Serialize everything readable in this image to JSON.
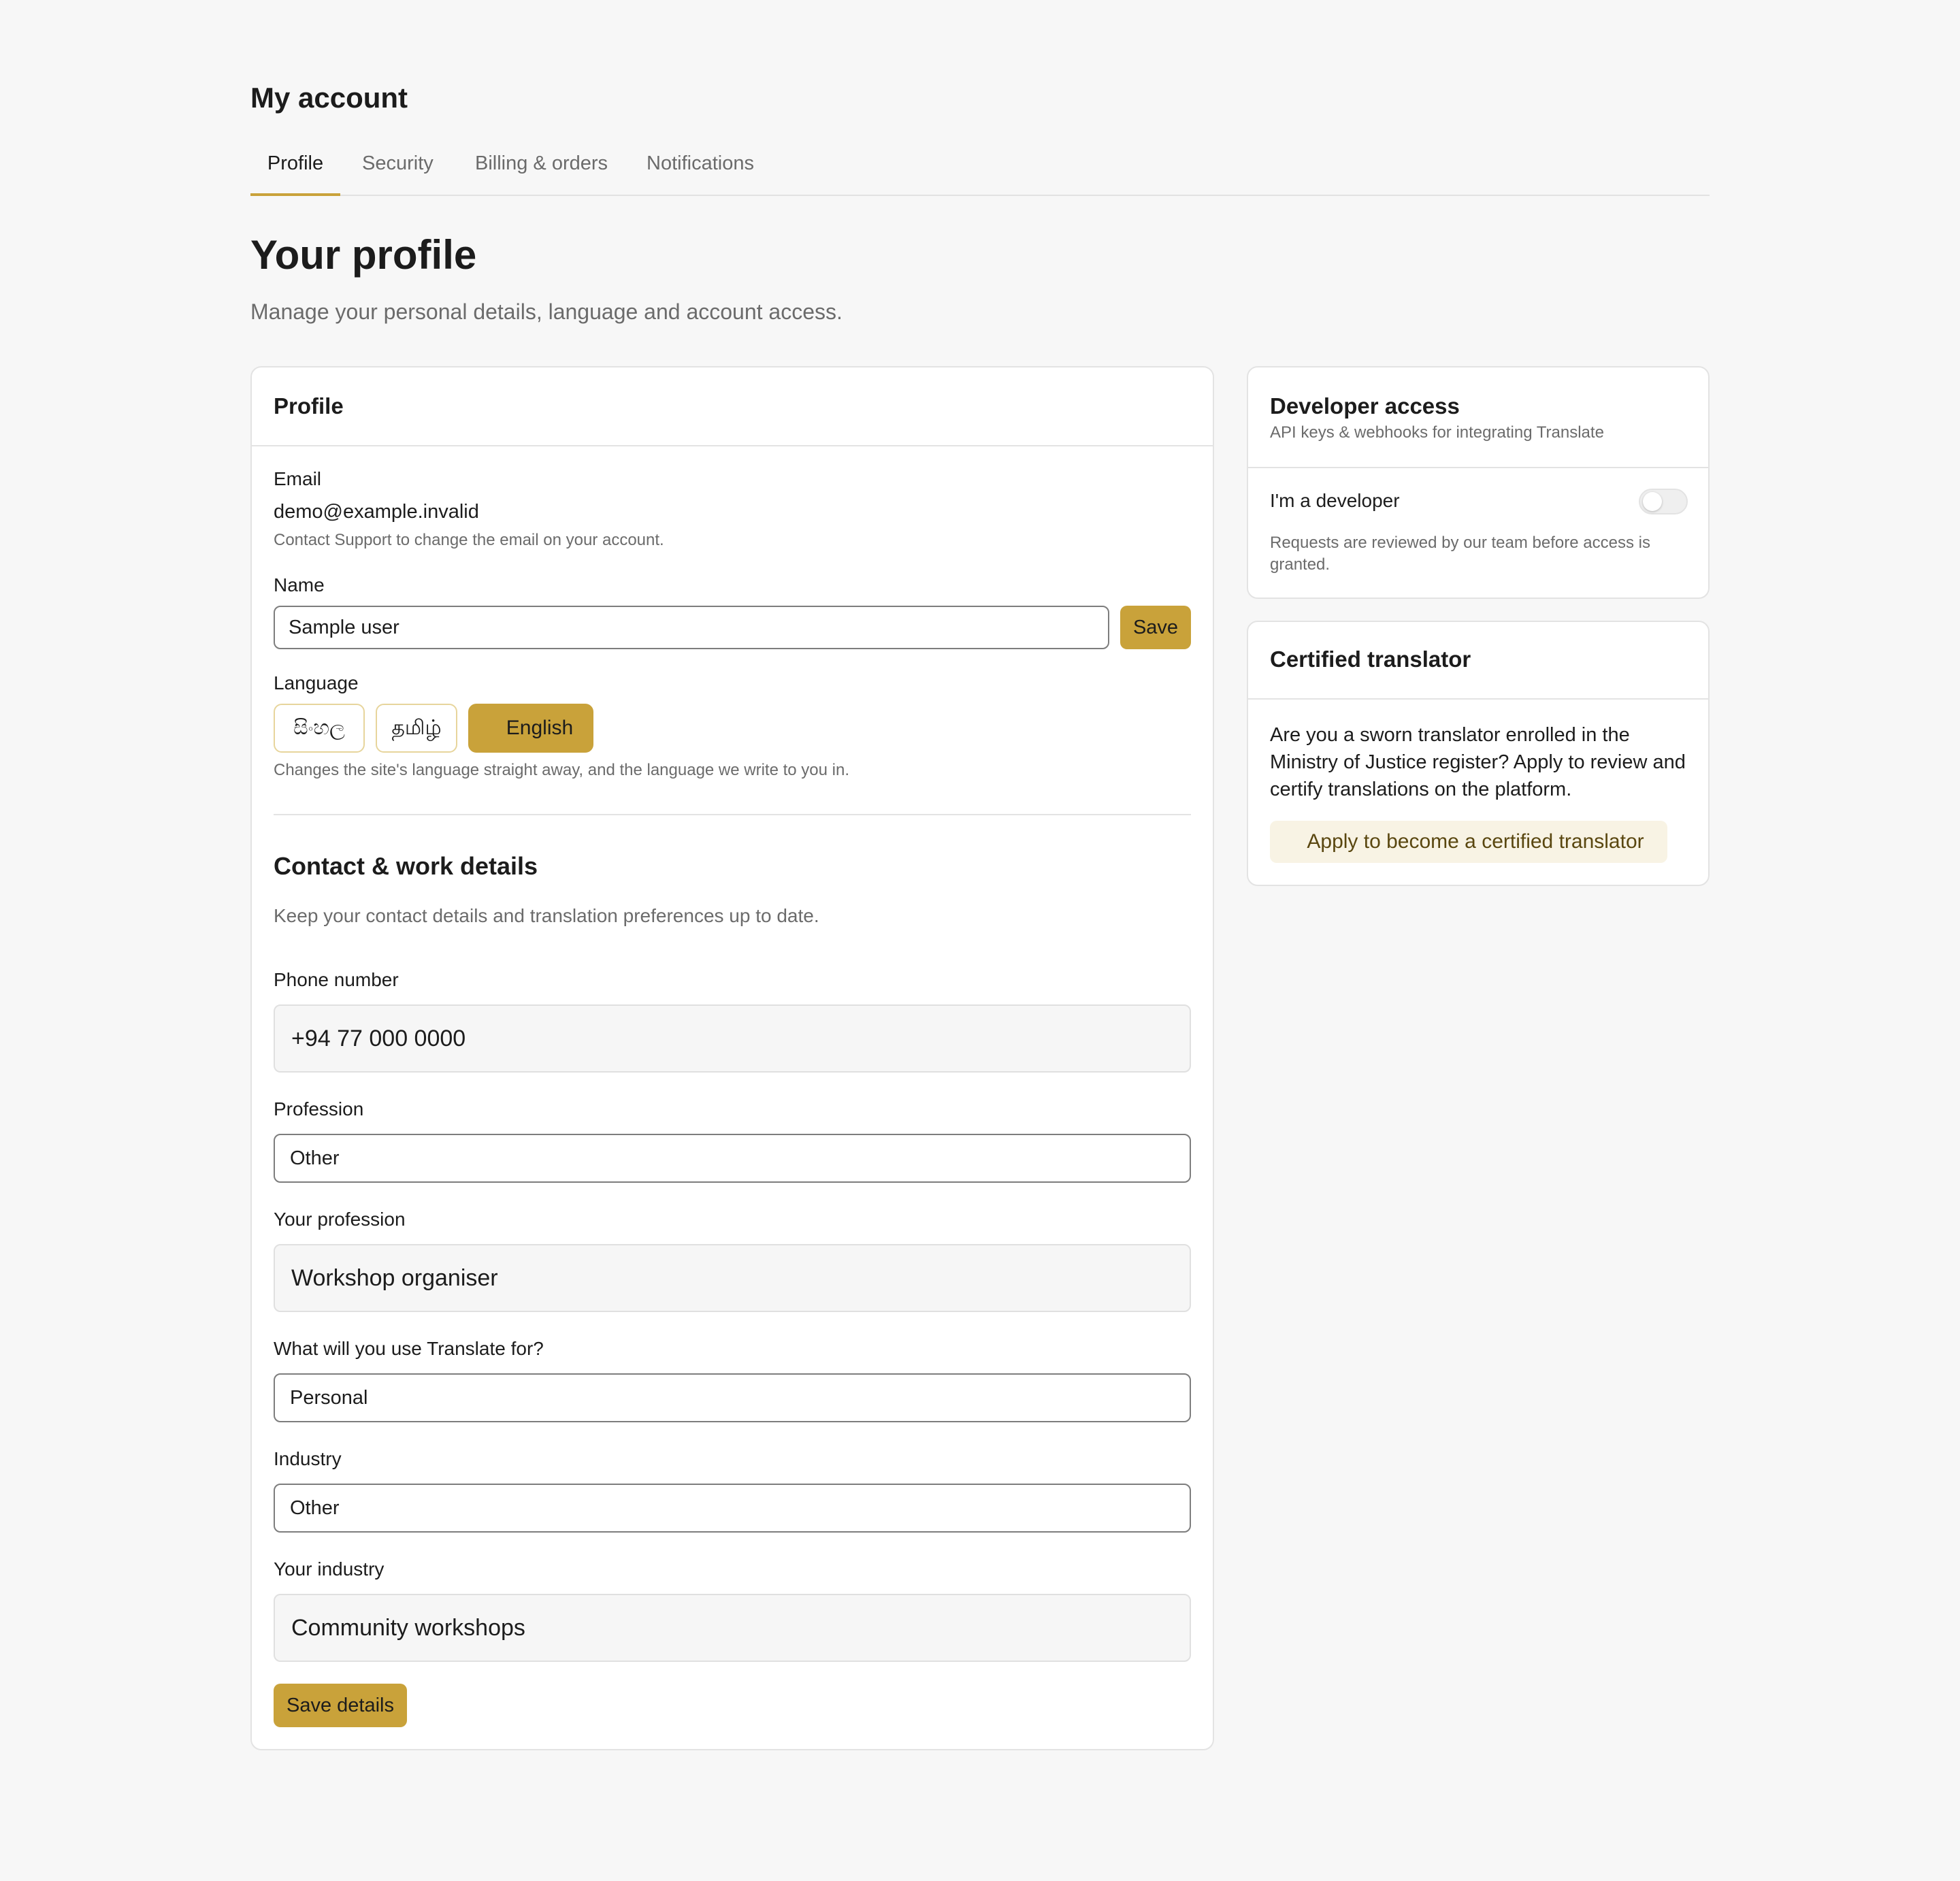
{
  "header": {
    "account_title": "My account",
    "tabs": [
      {
        "label": "Profile",
        "active": true
      },
      {
        "label": "Security",
        "active": false
      },
      {
        "label": "Billing & orders",
        "active": false
      },
      {
        "label": "Notifications",
        "active": false
      }
    ]
  },
  "page": {
    "title": "Your profile",
    "subtitle": "Manage your personal details, language and account access."
  },
  "profile_card": {
    "title": "Profile",
    "email": {
      "label": "Email",
      "value": "demo@example.invalid",
      "help": "Contact Support to change the email on your account."
    },
    "name": {
      "label": "Name",
      "value": "Sample user",
      "save_label": "Save"
    },
    "language": {
      "label": "Language",
      "options": [
        {
          "label": "සිංහල",
          "selected": false
        },
        {
          "label": "தமிழ்",
          "selected": false
        },
        {
          "label": "English",
          "selected": true
        }
      ],
      "help": "Changes the site's language straight away, and the language we write to you in."
    },
    "contact": {
      "title": "Contact & work details",
      "subtitle": "Keep your contact details and translation preferences up to date.",
      "phone_label": "Phone number",
      "phone_value": "+94 77 000 0000",
      "profession_label": "Profession",
      "profession_value": "Other",
      "your_profession_label": "Your profession",
      "your_profession_value": "Workshop organiser",
      "usage_label": "What will you use Translate for?",
      "usage_value": "Personal",
      "industry_label": "Industry",
      "industry_value": "Other",
      "your_industry_label": "Your industry",
      "your_industry_value": "Community workshops",
      "save_details_label": "Save details"
    }
  },
  "developer_card": {
    "title": "Developer access",
    "subtitle": "API keys & webhooks for integrating Translate",
    "toggle_label": "I'm a developer",
    "toggle_on": false,
    "help": "Requests are reviewed by our team before access is granted."
  },
  "translator_card": {
    "title": "Certified translator",
    "body": "Are you a sworn translator enrolled in the Ministry of Justice register? Apply to review and certify translations on the platform.",
    "apply_label": "Apply to become a certified translator"
  },
  "colors": {
    "accent": "#c9a23a",
    "background": "#f7f7f7",
    "card": "#ffffff",
    "muted_text": "#6b6b6b"
  }
}
